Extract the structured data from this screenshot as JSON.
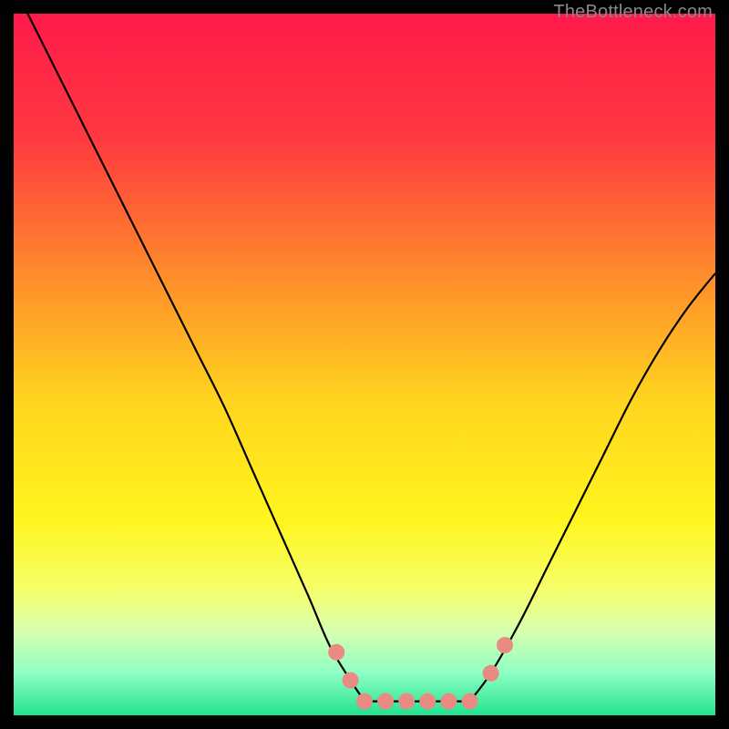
{
  "watermark": "TheBottleneck.com",
  "chart_data": {
    "type": "line",
    "title": "",
    "xlabel": "",
    "ylabel": "",
    "xlim": [
      0,
      100
    ],
    "ylim": [
      0,
      100
    ],
    "background_gradient": {
      "stops": [
        {
          "offset": 0.0,
          "color": "#ff1a4b"
        },
        {
          "offset": 0.18,
          "color": "#ff3a3f"
        },
        {
          "offset": 0.38,
          "color": "#ff8f2a"
        },
        {
          "offset": 0.55,
          "color": "#ffd41f"
        },
        {
          "offset": 0.72,
          "color": "#fff51d"
        },
        {
          "offset": 0.82,
          "color": "#f6ff6a"
        },
        {
          "offset": 0.88,
          "color": "#d8ffb0"
        },
        {
          "offset": 0.94,
          "color": "#8effc4"
        },
        {
          "offset": 1.0,
          "color": "#22e28f"
        }
      ]
    },
    "series": [
      {
        "name": "left-branch",
        "x": [
          2,
          6,
          10,
          14,
          18,
          22,
          26,
          30,
          34,
          38,
          42,
          45,
          48,
          50
        ],
        "y": [
          100,
          92,
          84,
          76,
          68,
          60,
          52,
          44,
          35,
          26,
          17,
          10,
          5,
          2
        ]
      },
      {
        "name": "valley-floor",
        "x": [
          50,
          52,
          55,
          58,
          62,
          65
        ],
        "y": [
          2,
          2,
          2,
          2,
          2,
          2
        ]
      },
      {
        "name": "right-branch",
        "x": [
          65,
          68,
          72,
          76,
          80,
          84,
          88,
          92,
          96,
          100
        ],
        "y": [
          2,
          6,
          13,
          21,
          29,
          37,
          45,
          52,
          58,
          63
        ]
      }
    ],
    "markers": {
      "name": "salmon-dots",
      "color": "#e98b82",
      "radius": 9,
      "points": [
        {
          "x": 46,
          "y": 9
        },
        {
          "x": 48,
          "y": 5
        },
        {
          "x": 50,
          "y": 2
        },
        {
          "x": 53,
          "y": 2
        },
        {
          "x": 56,
          "y": 2
        },
        {
          "x": 59,
          "y": 2
        },
        {
          "x": 62,
          "y": 2
        },
        {
          "x": 65,
          "y": 2
        },
        {
          "x": 68,
          "y": 6
        },
        {
          "x": 70,
          "y": 10
        }
      ]
    }
  }
}
